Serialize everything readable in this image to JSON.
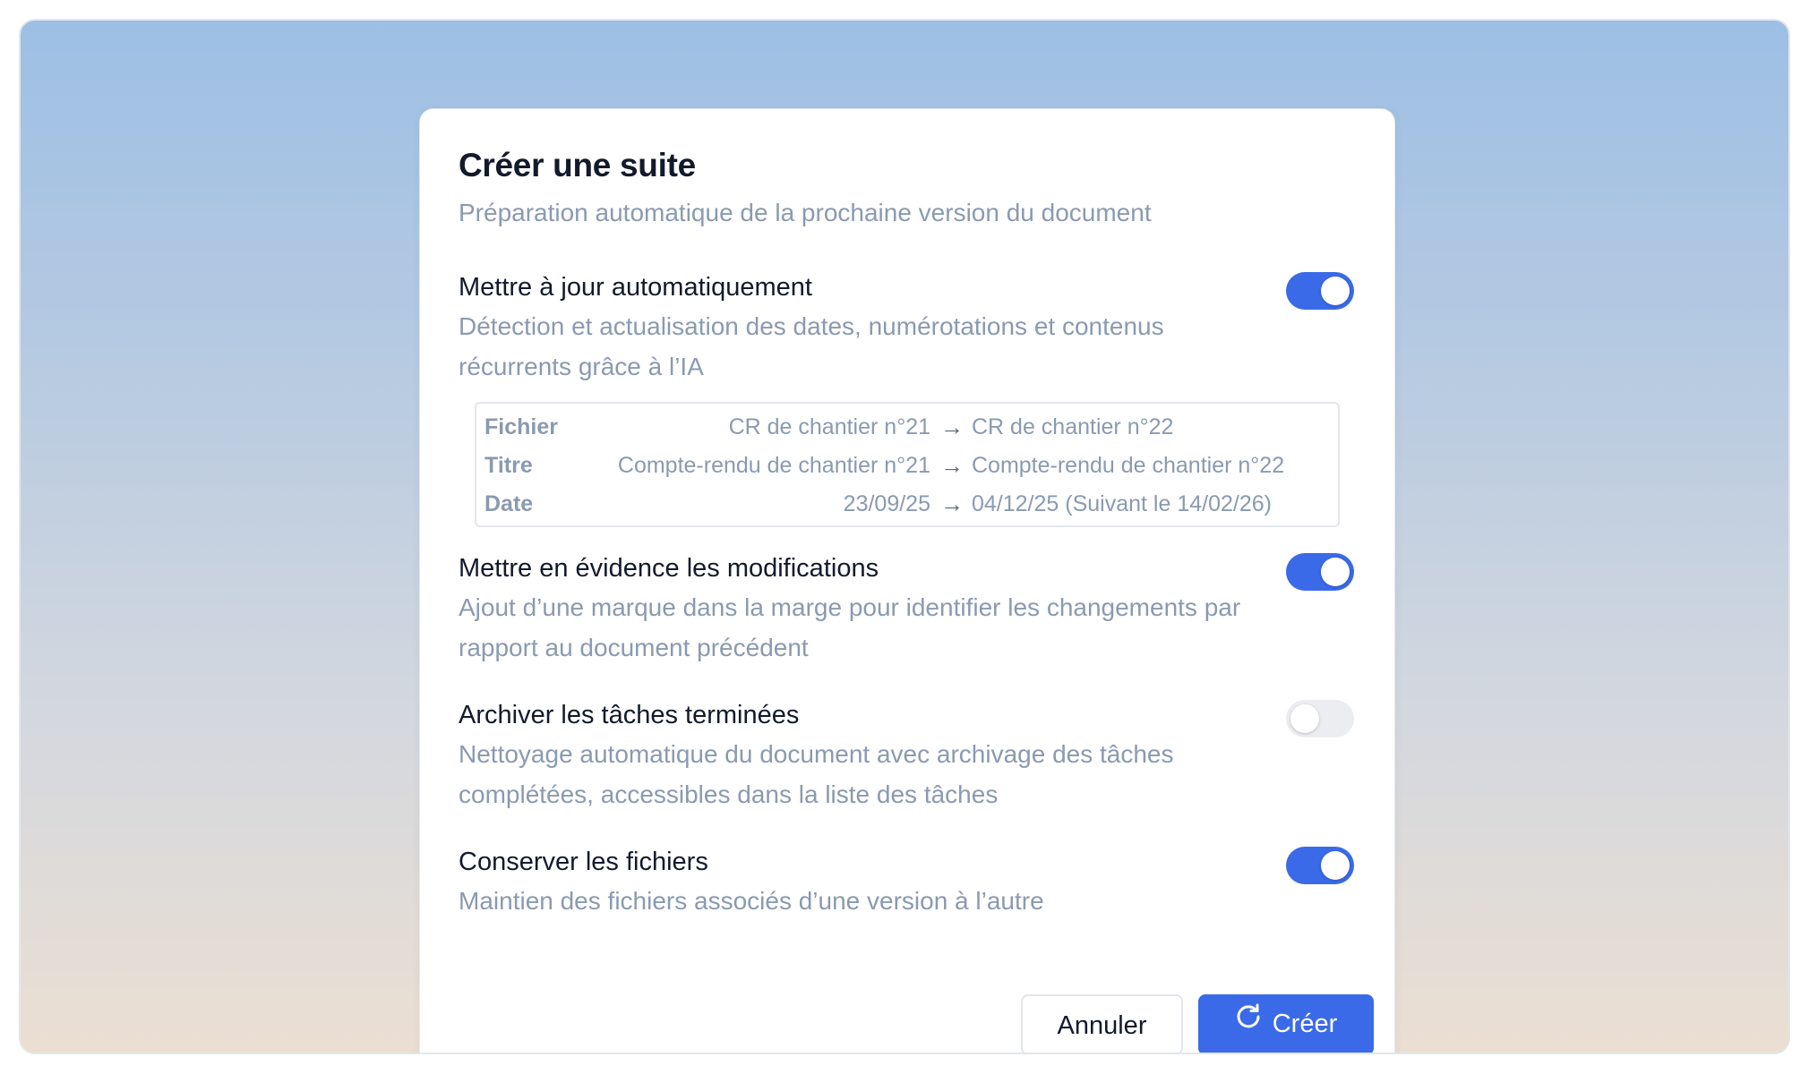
{
  "dialog": {
    "title": "Créer une suite",
    "subtitle": "Préparation automatique de la prochaine version du document"
  },
  "options": [
    {
      "title": "Mettre à jour automatiquement",
      "description": "Détection et actualisation des dates, numérotations et contenus récurrents grâce à l’IA",
      "enabled": true
    },
    {
      "title": "Mettre en évidence les modifications",
      "description": "Ajout d’une marque dans la marge pour identifier les changements par rapport au document précédent",
      "enabled": true
    },
    {
      "title": "Archiver les tâches terminées",
      "description": "Nettoyage automatique du document avec archivage des tâches complétées, accessibles dans la liste des tâches",
      "enabled": false
    },
    {
      "title": "Conserver les fichiers",
      "description": "Maintien des fichiers associés d’une version à l’autre",
      "enabled": true
    }
  ],
  "preview": {
    "rows": [
      {
        "label": "Fichier",
        "old": "CR de chantier n°21",
        "arrow": "→",
        "new": "CR de chantier n°22"
      },
      {
        "label": "Titre",
        "old": "Compte-rendu de chantier n°21",
        "arrow": "→",
        "new": "Compte-rendu de chantier n°22"
      },
      {
        "label": "Date",
        "old": "23/09/25",
        "arrow": "→",
        "new": "04/12/25 (Suivant le 14/02/26)"
      }
    ]
  },
  "buttons": {
    "cancel_label": "Annuler",
    "create_label": "Créer",
    "create_icon": "refresh-icon"
  },
  "colors": {
    "accent": "#3a6ae8",
    "title_text": "#121a2b",
    "muted_text": "#8a9ab0",
    "toggle_off": "#ebedf0"
  }
}
